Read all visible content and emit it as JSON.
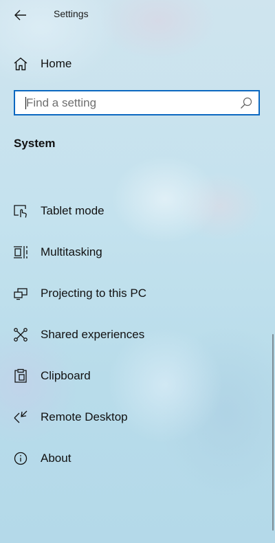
{
  "window": {
    "title": "Settings"
  },
  "home": {
    "label": "Home",
    "icon": "home-icon"
  },
  "search": {
    "placeholder": "Find a setting",
    "value": "",
    "icon": "search-icon",
    "border_color": "#0a67c0"
  },
  "section": {
    "heading": "System"
  },
  "nav": {
    "items": [
      {
        "label": "Tablet mode",
        "icon": "tablet-mode-icon"
      },
      {
        "label": "Multitasking",
        "icon": "multitasking-icon"
      },
      {
        "label": "Projecting to this PC",
        "icon": "projecting-icon"
      },
      {
        "label": "Shared experiences",
        "icon": "shared-experiences-icon"
      },
      {
        "label": "Clipboard",
        "icon": "clipboard-icon"
      },
      {
        "label": "Remote Desktop",
        "icon": "remote-desktop-icon"
      },
      {
        "label": "About",
        "icon": "info-icon"
      }
    ]
  },
  "colors": {
    "accent": "#0a67c0",
    "text": "#111111"
  }
}
